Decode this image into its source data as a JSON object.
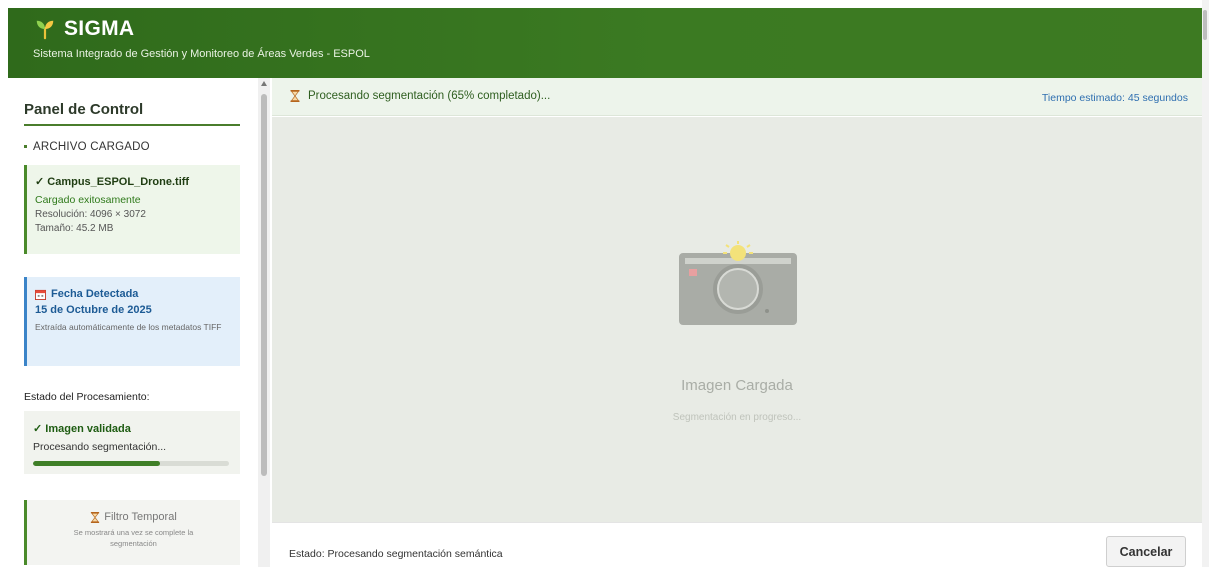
{
  "header": {
    "app_name": "SIGMA",
    "subtitle": "Sistema Integrado de Gestión y Monitoreo de Áreas Verdes - ESPOL",
    "icon": "sprout-icon",
    "color": "#3b7a22"
  },
  "sidebar": {
    "title": "Panel de Control",
    "file_section": {
      "label": "ARCHIVO CARGADO",
      "file_name": "✓ Campus_ESPOL_Drone.tiff",
      "status": "Cargado exitosamente",
      "resolution": "Resolución: 4096 × 3072",
      "size": "Tamaño: 45.2 MB"
    },
    "date_card": {
      "icon": "calendar-icon",
      "title": "Fecha Detectada",
      "value": "15 de Octubre de 2025",
      "note": "Extraída automáticamente de los metadatos TIFF"
    },
    "processing": {
      "label": "Estado del Procesamiento:",
      "validated": "✓ Imagen validada",
      "step": "Procesando segmentación...",
      "progress_percent": 65
    },
    "filter_card": {
      "icon": "hourglass-icon",
      "title": "Filtro Temporal",
      "note": "Se mostrará una vez se complete la segmentación"
    }
  },
  "main": {
    "status_message": "Procesando segmentación (65% completado)...",
    "status_icon": "hourglass-icon",
    "estimated_time": "Tiempo estimado: 45 segundos",
    "image_title": "Imagen Cargada",
    "image_subtitle": "Segmentación en progreso...",
    "image_icon": "camera-icon",
    "bottom_status": "Estado: Procesando segmentación semántica",
    "cancel_label": "Cancelar"
  }
}
